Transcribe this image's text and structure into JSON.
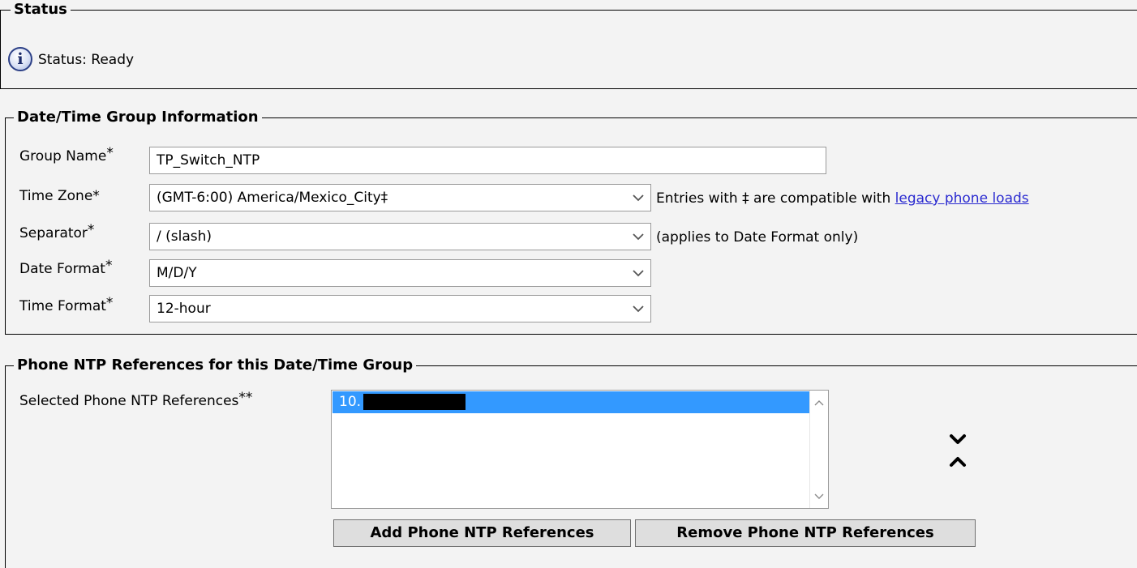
{
  "status_section": {
    "legend": "Status",
    "icon": "info-icon",
    "text": "Status: Ready"
  },
  "dtg_section": {
    "legend": "Date/Time Group Information",
    "group_name": {
      "label": "Group Name",
      "required": "*",
      "value": "TP_Switch_NTP"
    },
    "time_zone": {
      "label": "Time Zone*",
      "value": "(GMT-6:00) America/Mexico_City‡",
      "note_prefix": "Entries with ‡ are compatible with",
      "note_link": "legacy phone loads"
    },
    "separator": {
      "label": "Separator",
      "required": "*",
      "value": "/ (slash)",
      "note": "(applies to Date Format only)"
    },
    "date_format": {
      "label": "Date Format",
      "required": "*",
      "value": "M/D/Y"
    },
    "time_format": {
      "label": "Time Format",
      "required": "*",
      "value": "12-hour"
    }
  },
  "ntp_section": {
    "legend": "Phone NTP References for this Date/Time Group",
    "selected_label": "Selected Phone NTP References",
    "selected_required": "**",
    "items": [
      "10."
    ],
    "add_button": "Add Phone NTP References",
    "remove_button": "Remove Phone NTP References"
  },
  "colors": {
    "selection": "#3399ff",
    "link": "#2a2ad0",
    "background": "#f3f3f3"
  }
}
